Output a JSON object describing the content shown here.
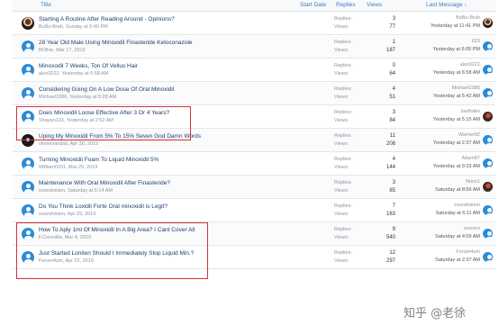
{
  "header": {
    "title": "Title",
    "start_date": "Start Date",
    "replies": "Replies",
    "views": "Views",
    "last_message": "Last Message ↓"
  },
  "labels": {
    "replies": "Replies:",
    "views": "Views:"
  },
  "threads": [
    {
      "title": "Starting A Routine After Reading Around - Opinions?",
      "meta": "BoBo-Brah, Sunday at 5:40 PM",
      "replies": "3",
      "views": "77",
      "last_user": "BoBo-Brah",
      "last_time": "Yesterday at 11:41 PM",
      "avatar": "photo-a",
      "last_avatar": "photo-a"
    },
    {
      "title": "28 Year Old Male Using Minoxidil Finasteride Ketoconazole",
      "meta": "BOlive, Mar 17, 2019",
      "replies": "1",
      "views": "187",
      "last_user": "623",
      "last_time": "Yesterday at 6:05 PM",
      "avatar": "default",
      "last_avatar": "default"
    },
    {
      "title": "Minoxodil 7 Weeks, Ton Of Vellus Hair",
      "meta": "alex9222, Yesterday at 6:58 AM",
      "replies": "0",
      "views": "64",
      "last_user": "alex9222",
      "last_time": "Yesterday at 6:58 AM",
      "avatar": "default",
      "last_avatar": "default"
    },
    {
      "title": "Considering Going On A Low Dose Of Oral Minoxidil",
      "meta": "Michael1986, Yesterday at 5:28 AM",
      "replies": "4",
      "views": "51",
      "last_user": "Michael1986",
      "last_time": "Yesterday at 5:42 AM",
      "avatar": "default",
      "last_avatar": "default"
    },
    {
      "title": "Does Minoxidil Loose Effective After 3 Or 4 Years?",
      "meta": "Shayan123, Yesterday at 2:52 AM",
      "replies": "3",
      "views": "84",
      "last_user": "badhabo",
      "last_time": "Yesterday at 5:15 AM",
      "avatar": "default",
      "last_avatar": "photo-c"
    },
    {
      "title": "Uping My Minoxidil From 5% To 15% Seven God Damn Words",
      "meta": "vinnievandall, Apr 30, 2019",
      "replies": "11",
      "views": "208",
      "last_user": "Warner82",
      "last_time": "Yesterday at 2:37 AM",
      "avatar": "photo-b",
      "last_avatar": "default"
    },
    {
      "title": "Turning Minoxidil Foam To Liquid Minoxidil 5%",
      "meta": "William0101, Mar 25, 2019",
      "replies": "4",
      "views": "144",
      "last_user": "Adam87",
      "last_time": "Yesterday at 9:33 AM",
      "avatar": "default",
      "last_avatar": "default"
    },
    {
      "title": "Maintenance With Oral Minoxidil After Finasteride?",
      "meta": "soundvision, Saturday at 6:14 AM",
      "replies": "3",
      "views": "85",
      "last_user": "Nnox1",
      "last_time": "Saturday at 8:56 AM",
      "avatar": "default",
      "last_avatar": "photo-c"
    },
    {
      "title": "Do You Think Loxidil Forte Oral minoxidil is Legit?",
      "meta": "soundvision, Apr 29, 2019",
      "replies": "7",
      "views": "163",
      "last_user": "soundvision",
      "last_time": "Saturday at 6:11 AM",
      "avatar": "default",
      "last_avatar": "default"
    },
    {
      "title": "How To Aply 1ml Of Minoxidil In A Big Area? I Cant Cover All",
      "meta": "F.Corovilla, Mar 4, 2019",
      "replies": "9",
      "views": "540",
      "last_user": "reucers",
      "last_time": "Saturday at 4:09 AM",
      "avatar": "default",
      "last_avatar": "default"
    },
    {
      "title": "Just Started Loniten Should I Immediately Stop Liquid Min.?",
      "meta": "Forum4um, Apr 22, 2019",
      "replies": "12",
      "views": "297",
      "last_user": "Forum4um",
      "last_time": "Saturday at 2:37 AM",
      "avatar": "default",
      "last_avatar": "default"
    }
  ],
  "watermark": "知乎 @老徐"
}
